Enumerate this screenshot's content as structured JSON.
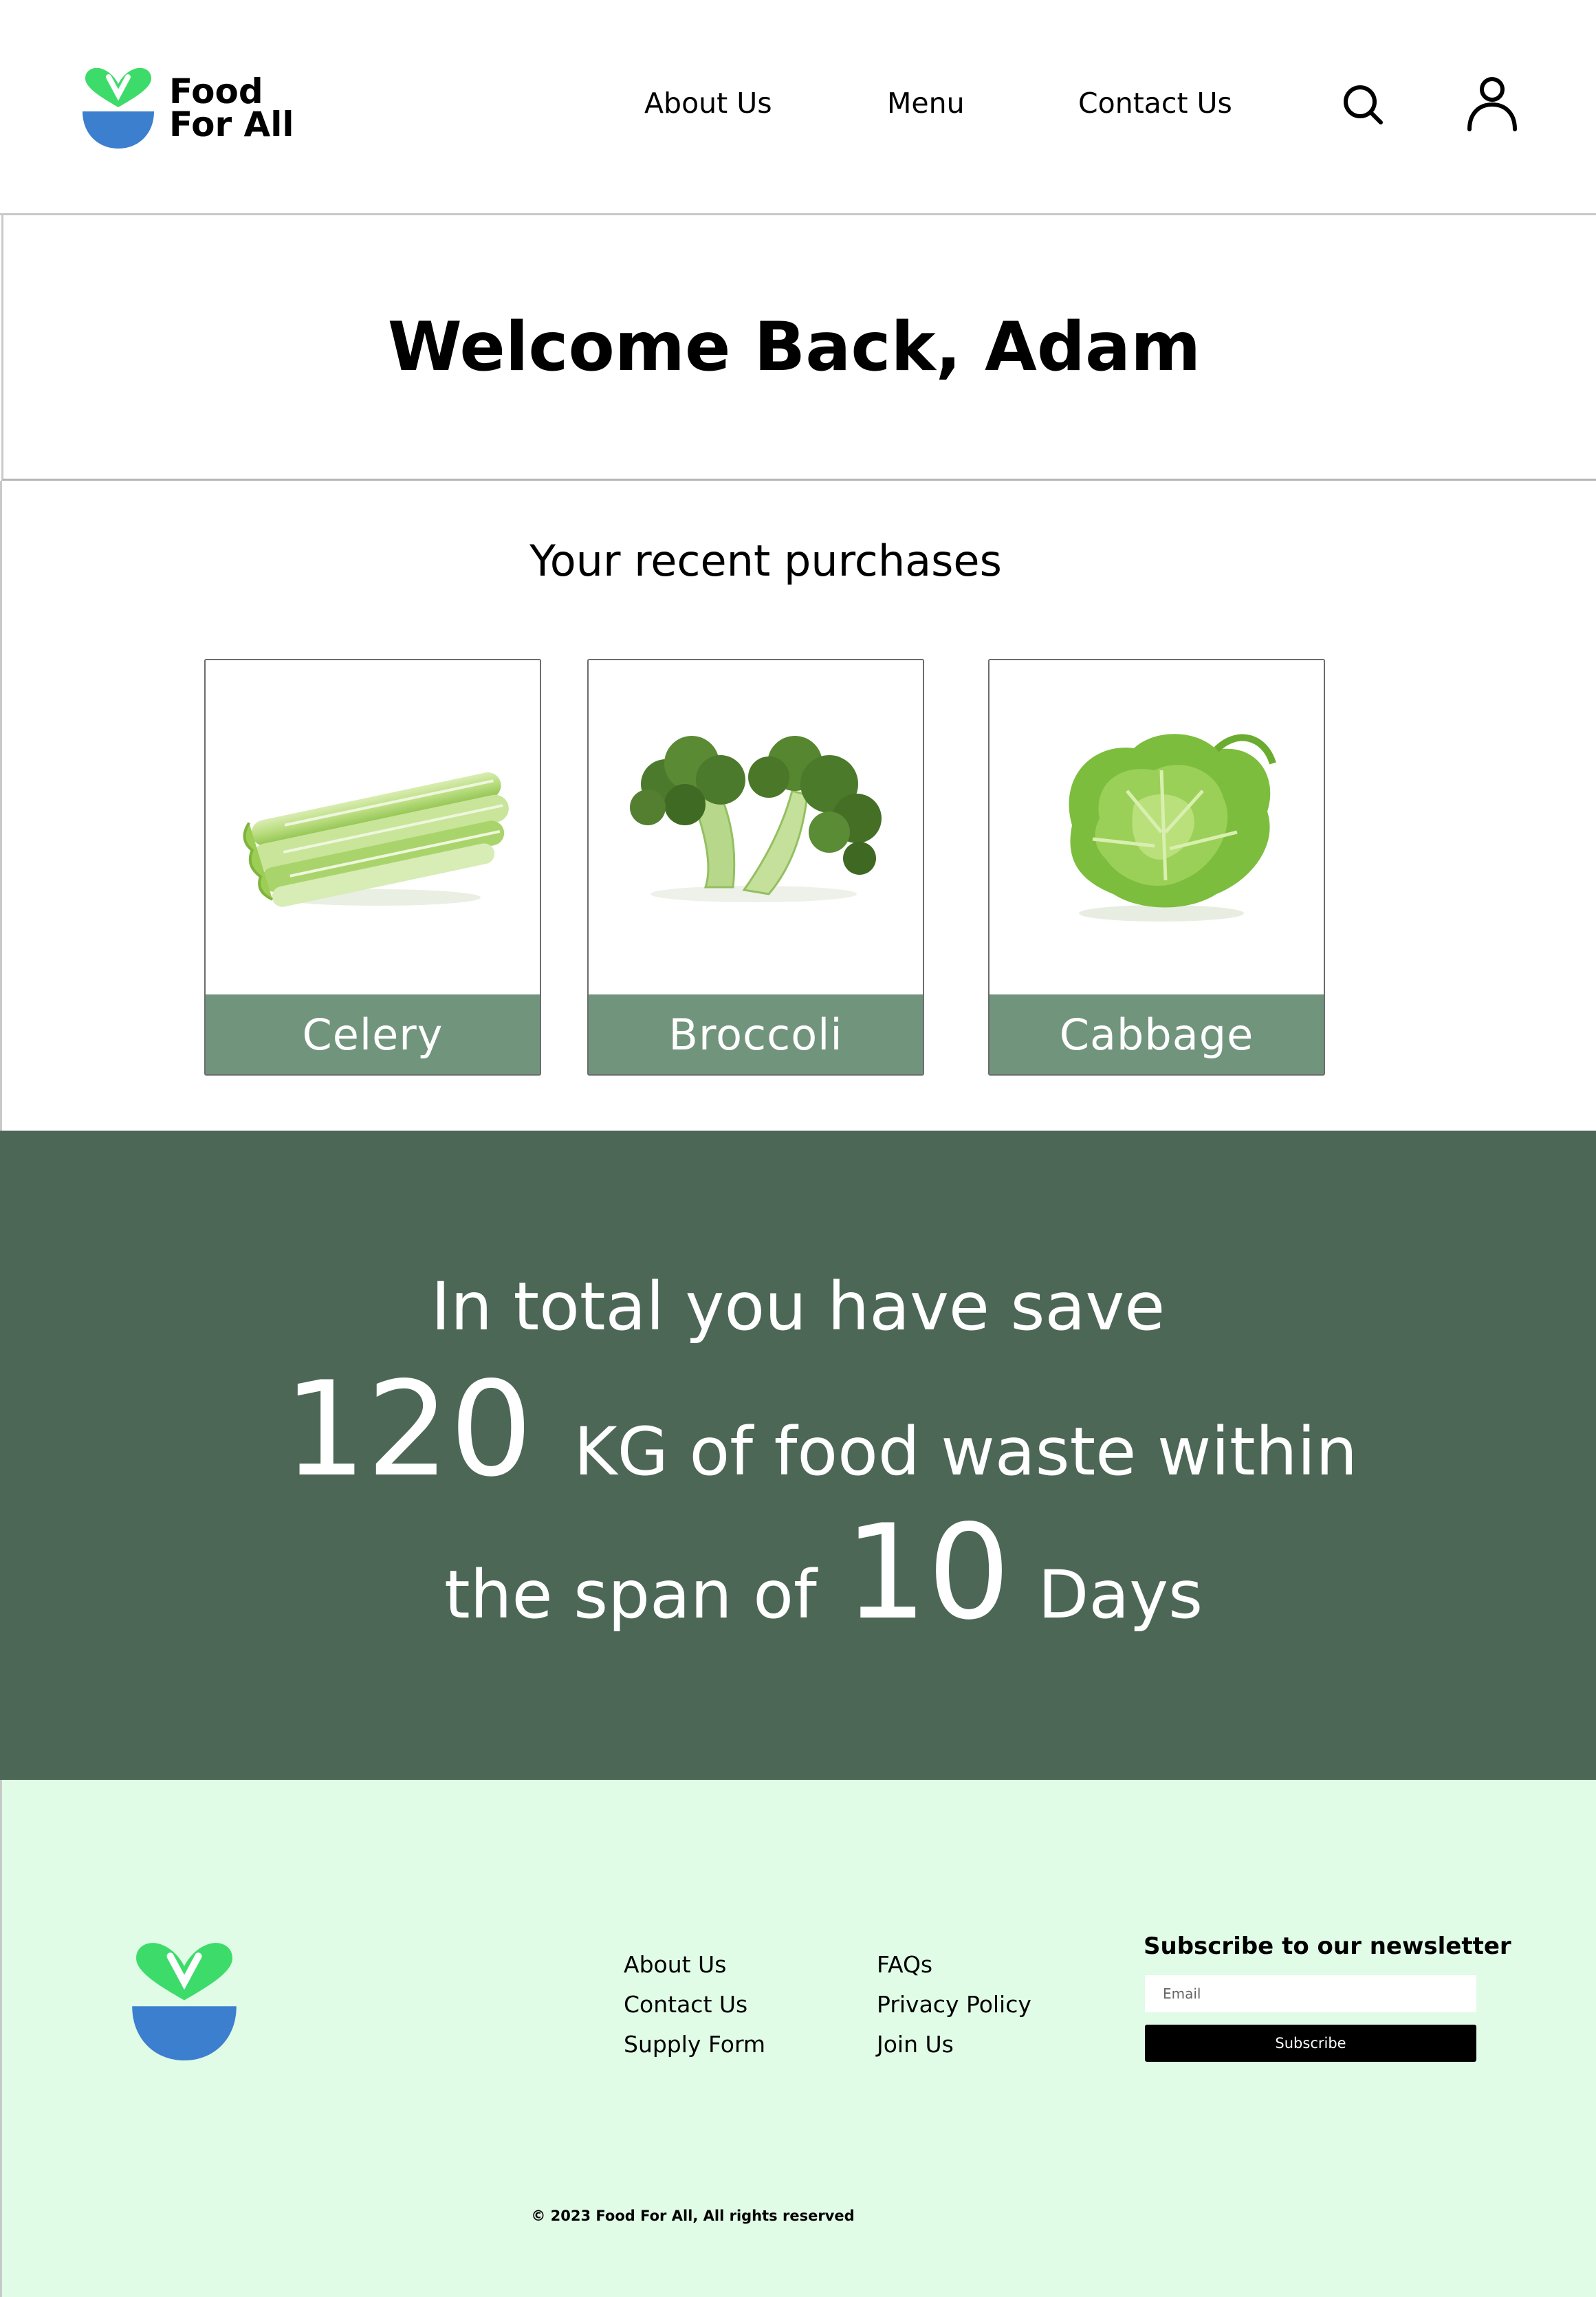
{
  "brand": {
    "name_line1": "Food",
    "name_line2": "For All",
    "colors": {
      "leaf": "#3ddc6a",
      "bowl": "#3b7fce"
    }
  },
  "header": {
    "nav": [
      "About Us",
      "Menu",
      "Contact Us"
    ],
    "icons": [
      "search-icon",
      "user-icon"
    ]
  },
  "welcome": {
    "title": "Welcome Back, Adam"
  },
  "recent": {
    "title": "Your recent purchases",
    "items": [
      {
        "label": "Celery",
        "image": "celery-image"
      },
      {
        "label": "Broccoli",
        "image": "broccoli-image"
      },
      {
        "label": "Cabbage",
        "image": "cabbage-image"
      }
    ],
    "card_label_color": "#71947c"
  },
  "stats": {
    "line1": "In total you have save",
    "amount": "120",
    "amount_text": "KG of food waste within",
    "span_prefix": "the span of",
    "days": "10",
    "days_suffix": "Days",
    "background": "#4c6756"
  },
  "footer": {
    "links_col1": [
      "About Us",
      "Contact Us",
      "Supply Form"
    ],
    "links_col2": [
      "FAQs",
      "Privacy Policy",
      "Join Us"
    ],
    "newsletter": {
      "title": "Subscribe to our newsletter",
      "email_placeholder": "Email",
      "button_label": "Subscribe"
    },
    "copyright": "© 2023 Food For All, All rights reserved",
    "background": "#e0fbe6"
  }
}
